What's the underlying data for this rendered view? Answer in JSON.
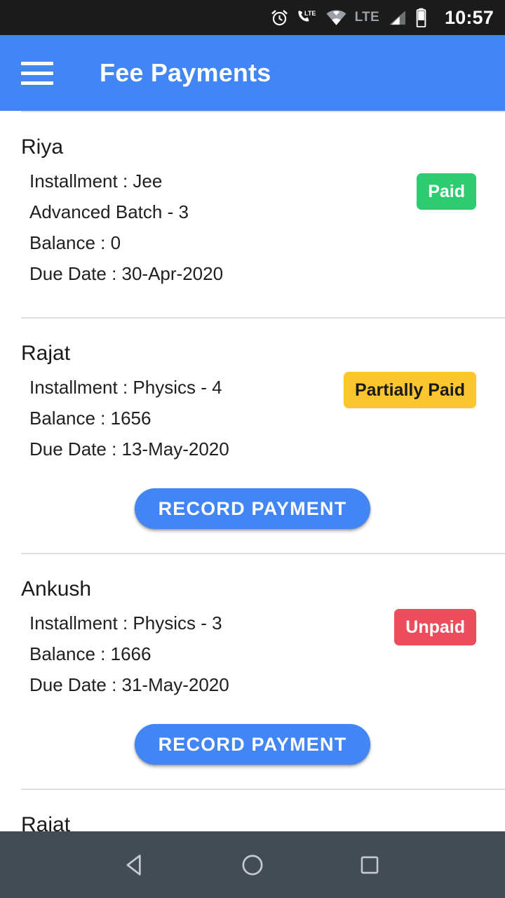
{
  "status_bar": {
    "icons": [
      "alarm-icon",
      "phone-lte-icon",
      "wifi-icon",
      "lte-label",
      "signal-icon",
      "battery-icon"
    ],
    "lte_label": "LTE",
    "time": "10:57",
    "background": "#1b1b1b"
  },
  "app_bar": {
    "menu_icon": "hamburger-menu-icon",
    "title": "Fee Payments",
    "background": "#4285f4"
  },
  "colors": {
    "accent": "#4285f4",
    "paid": "#2ecc71",
    "partially_paid": "#fdc62e",
    "unpaid": "#ed4c5c",
    "nav_bar": "#434c54"
  },
  "payments": [
    {
      "name": "Riya",
      "installment": "Installment : Jee\nAdvanced Batch - 3",
      "balance": "Balance : 0",
      "due_date": "Due Date : 30-Apr-2020",
      "status": "Paid",
      "has_button": false,
      "button_label": ""
    },
    {
      "name": "Rajat",
      "installment": "Installment : Physics - 4",
      "balance": "Balance : 1656",
      "due_date": "Due Date : 13-May-2020",
      "status": "Partially Paid",
      "has_button": true,
      "button_label": "RECORD PAYMENT"
    },
    {
      "name": "Ankush",
      "installment": "Installment : Physics - 3",
      "balance": "Balance : 1666",
      "due_date": "Due Date : 31-May-2020",
      "status": "Unpaid",
      "has_button": true,
      "button_label": "RECORD PAYMENT"
    },
    {
      "name": "Rajat",
      "installment": "",
      "balance": "",
      "due_date": "",
      "status": "",
      "has_button": false,
      "button_label": ""
    }
  ],
  "nav_bar": {
    "back": "back-triangle-icon",
    "home": "home-circle-icon",
    "recents": "recents-square-icon"
  }
}
